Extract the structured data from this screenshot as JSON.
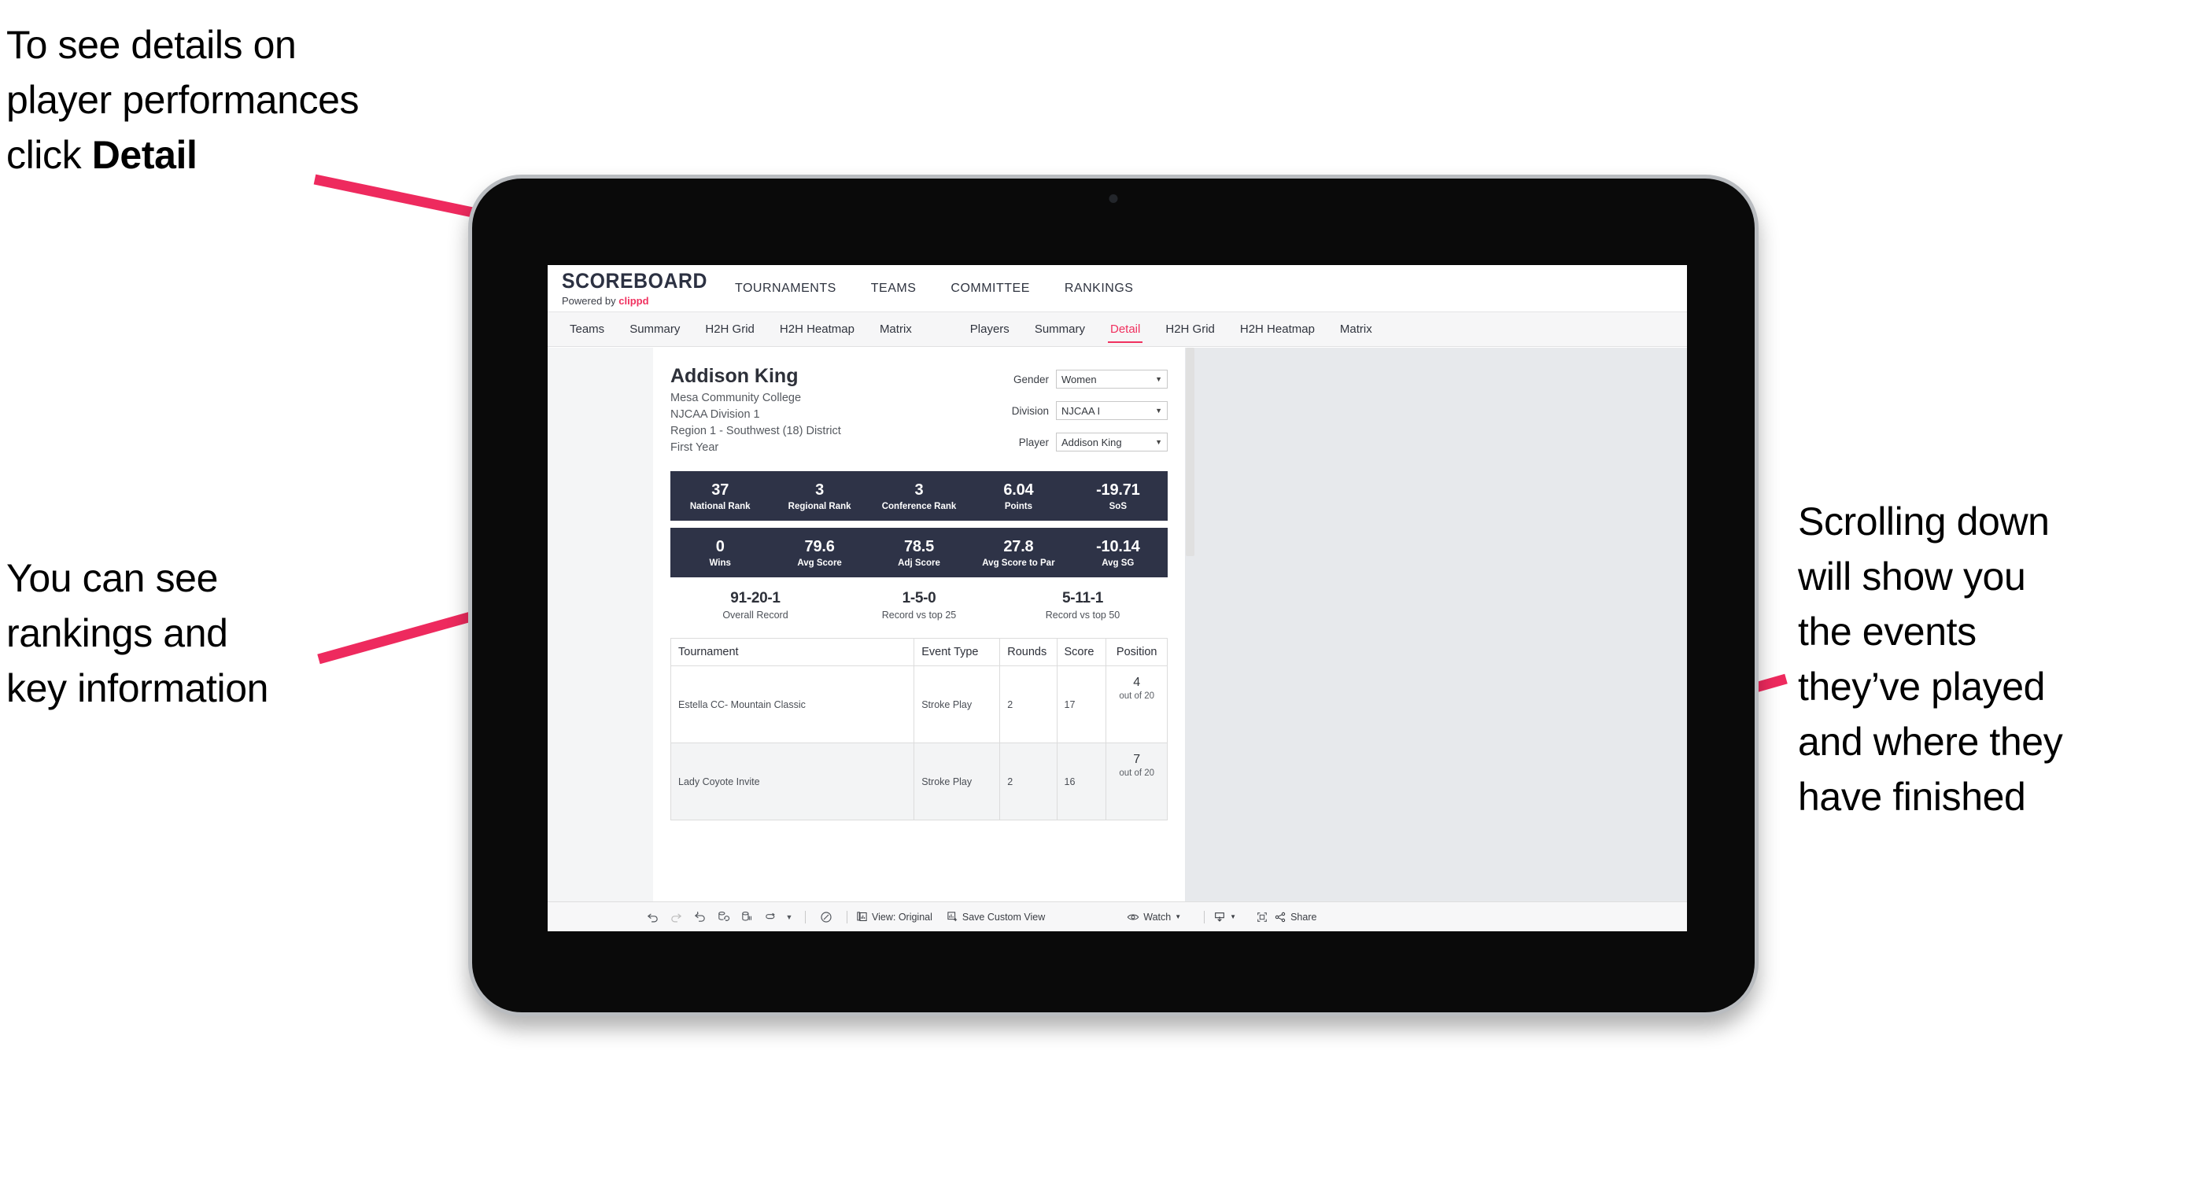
{
  "annotations": {
    "detail": "To see details on\nplayer performances\nclick ",
    "detail_bold": "Detail",
    "rankings": "You can see\nrankings and\nkey information",
    "scrolling": "Scrolling down\nwill show you\nthe events\nthey’ve played\nand where they\nhave finished"
  },
  "app": {
    "brand": {
      "title": "SCOREBOARD",
      "powered_prefix": "Powered by ",
      "powered_brand": "clippd"
    },
    "topnav": [
      "TOURNAMENTS",
      "TEAMS",
      "COMMITTEE",
      "RANKINGS"
    ],
    "subnav_teams": [
      "Teams",
      "Summary",
      "H2H Grid",
      "H2H Heatmap",
      "Matrix"
    ],
    "subnav_players": [
      "Players",
      "Summary",
      "Detail",
      "H2H Grid",
      "H2H Heatmap",
      "Matrix"
    ],
    "subnav_active": "Detail"
  },
  "player": {
    "name": "Addison King",
    "college": "Mesa Community College",
    "division": "NJCAA Division 1",
    "region": "Region 1 - Southwest (18) District",
    "year": "First Year"
  },
  "filters": [
    {
      "label": "Gender",
      "value": "Women"
    },
    {
      "label": "Division",
      "value": "NJCAA I"
    },
    {
      "label": "Player",
      "value": "Addison King"
    }
  ],
  "stats_band_1": [
    {
      "value": "37",
      "label": "National Rank"
    },
    {
      "value": "3",
      "label": "Regional Rank"
    },
    {
      "value": "3",
      "label": "Conference Rank"
    },
    {
      "value": "6.04",
      "label": "Points"
    },
    {
      "value": "-19.71",
      "label": "SoS"
    }
  ],
  "stats_band_2": [
    {
      "value": "0",
      "label": "Wins"
    },
    {
      "value": "79.6",
      "label": "Avg Score"
    },
    {
      "value": "78.5",
      "label": "Adj Score"
    },
    {
      "value": "27.8",
      "label": "Avg Score to Par"
    },
    {
      "value": "-10.14",
      "label": "Avg SG"
    }
  ],
  "records": [
    {
      "value": "91-20-1",
      "label": "Overall Record"
    },
    {
      "value": "1-5-0",
      "label": "Record vs top 25"
    },
    {
      "value": "5-11-1",
      "label": "Record vs top 50"
    }
  ],
  "table": {
    "headers": [
      "Tournament",
      "Event Type",
      "Rounds",
      "Score",
      "Position"
    ],
    "rows": [
      {
        "tournament": "Estella CC- Mountain Classic",
        "event_type": "Stroke Play",
        "rounds": "2",
        "score": "17",
        "position": "4",
        "position_sub": "out of 20"
      },
      {
        "tournament": "Lady Coyote Invite",
        "event_type": "Stroke Play",
        "rounds": "2",
        "score": "16",
        "position": "7",
        "position_sub": "out of 20"
      }
    ]
  },
  "toolbar": {
    "view_label": "View: Original",
    "save_label": "Save Custom View",
    "watch_label": "Watch",
    "share_label": "Share"
  },
  "colors": {
    "accent_pink": "#f0315f",
    "band_navy": "#2e3347",
    "workspace_gray": "#e7e9ec"
  }
}
